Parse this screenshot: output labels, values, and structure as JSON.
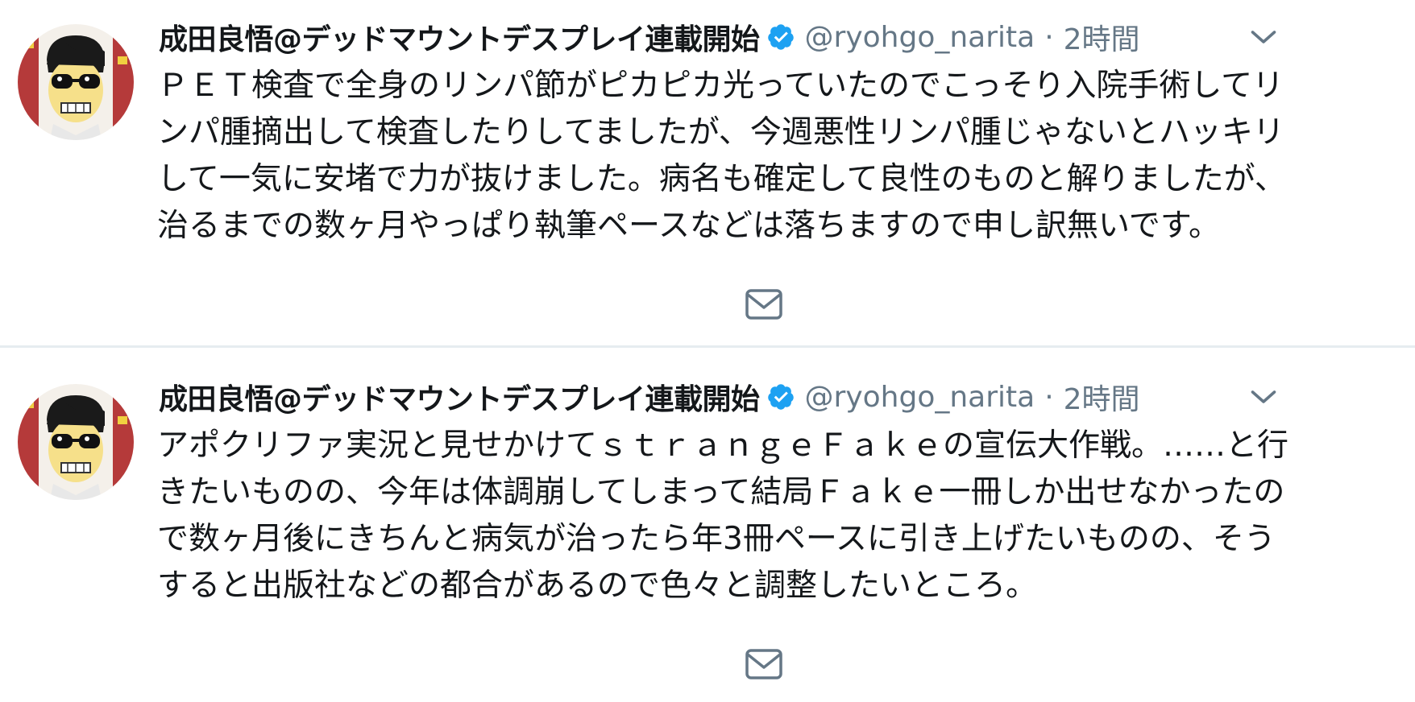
{
  "tweets": [
    {
      "author": {
        "display_name": "成田良悟@デッドマウントデスプレイ連載開始",
        "handle": "@ryohgo_narita",
        "verified": true
      },
      "separator": "·",
      "time": "2時間",
      "text": "ＰＥＴ検査で全身のリンパ節がピカピカ光っていたのでこっそり入院手術してリ\nンパ腫摘出して検査したりしてましたが、今週悪性リンパ腫じゃないとハッキリ\nして一気に安堵で力が抜けました。病名も確定して良性のものと解りましたが、\n治るまでの数ヶ月やっぱり執筆ペースなどは落ちますので申し訳無いです。",
      "icons": {
        "more": "chevron-down-icon",
        "dm": "envelope-icon",
        "verified": "verified-badge-icon"
      }
    },
    {
      "author": {
        "display_name": "成田良悟@デッドマウントデスプレイ連載開始",
        "handle": "@ryohgo_narita",
        "verified": true
      },
      "separator": "·",
      "time": "2時間",
      "text": "アポクリファ実況と見せかけてｓｔｒａｎｇｅＦａｋｅの宣伝大作戦。……と行\nきたいものの、今年は体調崩してしまって結局Ｆａｋｅ一冊しか出せなかったの\nで数ヶ月後にきちんと病気が治ったら年3冊ペースに引き上げたいものの、そう\nすると出版社などの都合があるので色々と調整したいところ。",
      "icons": {
        "more": "chevron-down-icon",
        "dm": "envelope-icon",
        "verified": "verified-badge-icon"
      }
    }
  ],
  "colors": {
    "text": "#14171a",
    "secondary": "#657786",
    "verified": "#1da1f2",
    "divider": "#e6ecf0"
  }
}
